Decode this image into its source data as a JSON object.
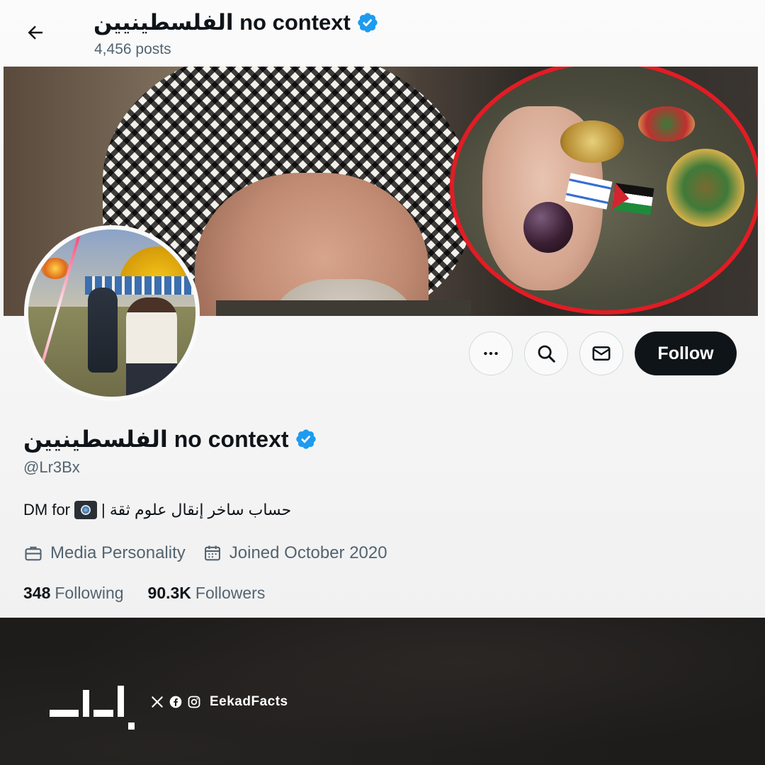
{
  "header": {
    "display_name": "الفلسطينيين no context",
    "post_count": "4,456 posts"
  },
  "profile": {
    "display_name": "الفلسطينيين no context",
    "handle": "@Lr3Bx",
    "bio": {
      "arabic_text": "حساب ساخر إنقال علوم ثقة |",
      "dm_text": "DM for"
    },
    "category": "Media Personality",
    "joined": "Joined October 2020",
    "following": {
      "count": "348",
      "label": "Following"
    },
    "followers": {
      "count": "90.3K",
      "label": "Followers"
    }
  },
  "actions": {
    "follow_label": "Follow"
  },
  "icons": {
    "back": "arrow-left-icon",
    "verified": "verified-badge-icon",
    "more": "more-horizontal-icon",
    "search": "search-icon",
    "message": "envelope-icon",
    "category": "briefcase-icon",
    "joined": "calendar-icon",
    "camera": "camera-icon"
  },
  "colors": {
    "verified_blue": "#1d9bf0",
    "follow_bg": "#0f1419",
    "secondary_text": "#536471",
    "banner_circle_red": "#e21c24"
  },
  "footer": {
    "social_handle": "EekadFacts"
  }
}
